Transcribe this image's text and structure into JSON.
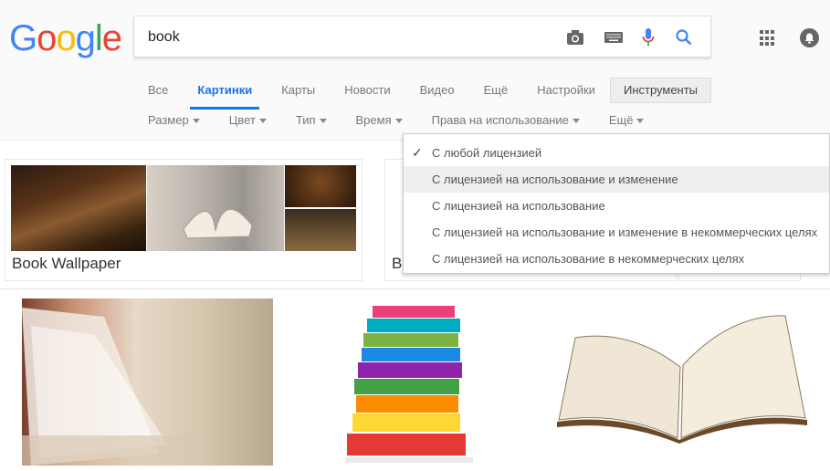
{
  "logo": {
    "letters": [
      "G",
      "o",
      "o",
      "g",
      "l",
      "e"
    ]
  },
  "search": {
    "value": "book"
  },
  "tabs": [
    {
      "label": "Все"
    },
    {
      "label": "Картинки"
    },
    {
      "label": "Карты"
    },
    {
      "label": "Новости"
    },
    {
      "label": "Видео"
    },
    {
      "label": "Ещё"
    },
    {
      "label": "Настройки"
    }
  ],
  "tools_label": "Инструменты",
  "filters": [
    {
      "label": "Размер"
    },
    {
      "label": "Цвет"
    },
    {
      "label": "Тип"
    },
    {
      "label": "Время"
    },
    {
      "label": "Права на использование"
    },
    {
      "label": "Ещё"
    }
  ],
  "cards": [
    {
      "caption": "Book Wallpaper"
    },
    {
      "caption": "B"
    }
  ],
  "license_menu": {
    "items": [
      {
        "label": "С любой лицензией",
        "checked": true
      },
      {
        "label": "С лицензией на использование и изменение"
      },
      {
        "label": "С лицензией на использование"
      },
      {
        "label": "С лицензией на использование и изменение в некоммерческих целях"
      },
      {
        "label": "С лицензией на использование в некоммерческих целях"
      }
    ]
  },
  "colors": {
    "accent": "#1a73e8"
  }
}
